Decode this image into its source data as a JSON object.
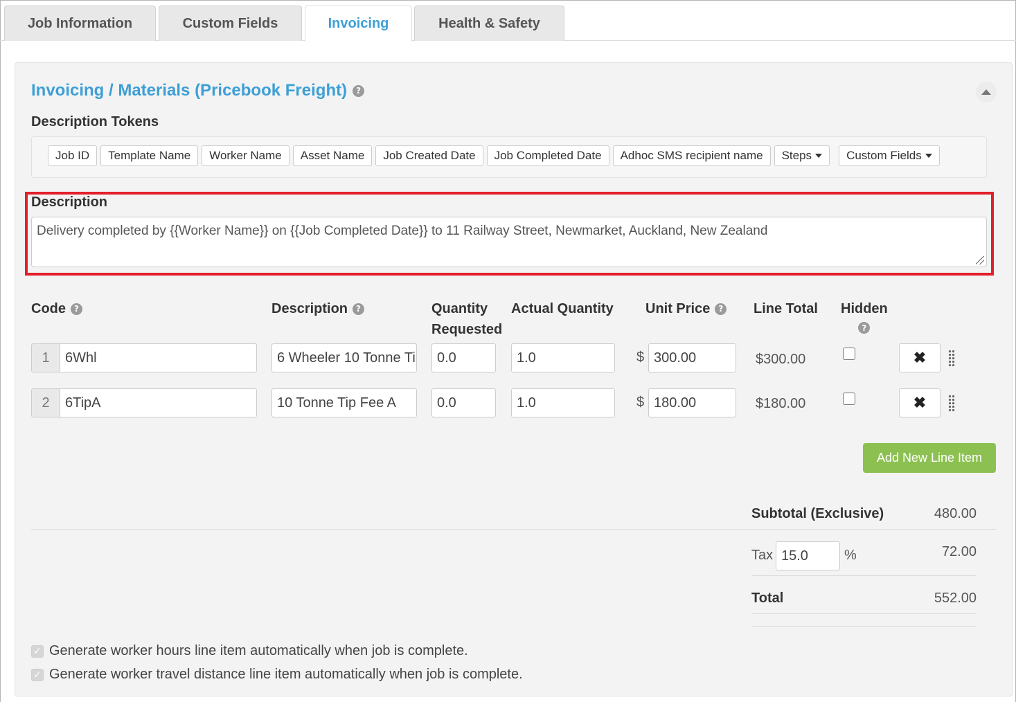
{
  "tabs": [
    {
      "label": "Job Information",
      "active": false
    },
    {
      "label": "Custom Fields",
      "active": false
    },
    {
      "label": "Invoicing",
      "active": true
    },
    {
      "label": "Health & Safety",
      "active": false
    }
  ],
  "panel": {
    "title": "Invoicing / Materials (Pricebook Freight)",
    "help_icon": "?"
  },
  "tokens": {
    "label": "Description Tokens",
    "items": [
      "Job ID",
      "Template Name",
      "Worker Name",
      "Asset Name",
      "Job Created Date",
      "Job Completed Date",
      "Adhoc SMS recipient name"
    ],
    "dropdowns": [
      "Steps",
      "Custom Fields"
    ]
  },
  "description": {
    "label": "Description",
    "value": "Delivery completed by {{Worker Name}} on {{Job Completed Date}} to 11 Railway Street, Newmarket, Auckland, New Zealand"
  },
  "table": {
    "headers": {
      "code": "Code",
      "description": "Description",
      "qty_requested_1": "Quantity",
      "qty_requested_2": "Requested",
      "actual_quantity": "Actual Quantity",
      "unit_price": "Unit Price",
      "line_total": "Line Total",
      "hidden": "Hidden"
    },
    "currency_symbol": "$",
    "rows": [
      {
        "num": "1",
        "code": "6Whl",
        "description": "6 Wheeler 10 Tonne Ti",
        "qty_requested": "0.0",
        "actual_quantity": "1.0",
        "unit_price": "300.00",
        "line_total": "$300.00",
        "hidden": false
      },
      {
        "num": "2",
        "code": "6TipA",
        "description": "10 Tonne Tip Fee A",
        "qty_requested": "0.0",
        "actual_quantity": "1.0",
        "unit_price": "180.00",
        "line_total": "$180.00",
        "hidden": false
      }
    ],
    "delete_icon": "✖"
  },
  "add_button": "Add New Line Item",
  "summary": {
    "subtotal_label": "Subtotal (Exclusive)",
    "subtotal_value": "480.00",
    "tax_label": "Tax",
    "tax_rate": "15.0",
    "tax_unit": "%",
    "tax_value": "72.00",
    "total_label": "Total",
    "total_value": "552.00"
  },
  "options": [
    {
      "label": "Generate worker hours line item automatically when job is complete.",
      "checked": true
    },
    {
      "label": "Generate worker travel distance line item automatically when job is complete.",
      "checked": true
    }
  ],
  "colors": {
    "accent": "#3d9fd6",
    "add_button": "#8cc152",
    "highlight": "#e2202b"
  }
}
